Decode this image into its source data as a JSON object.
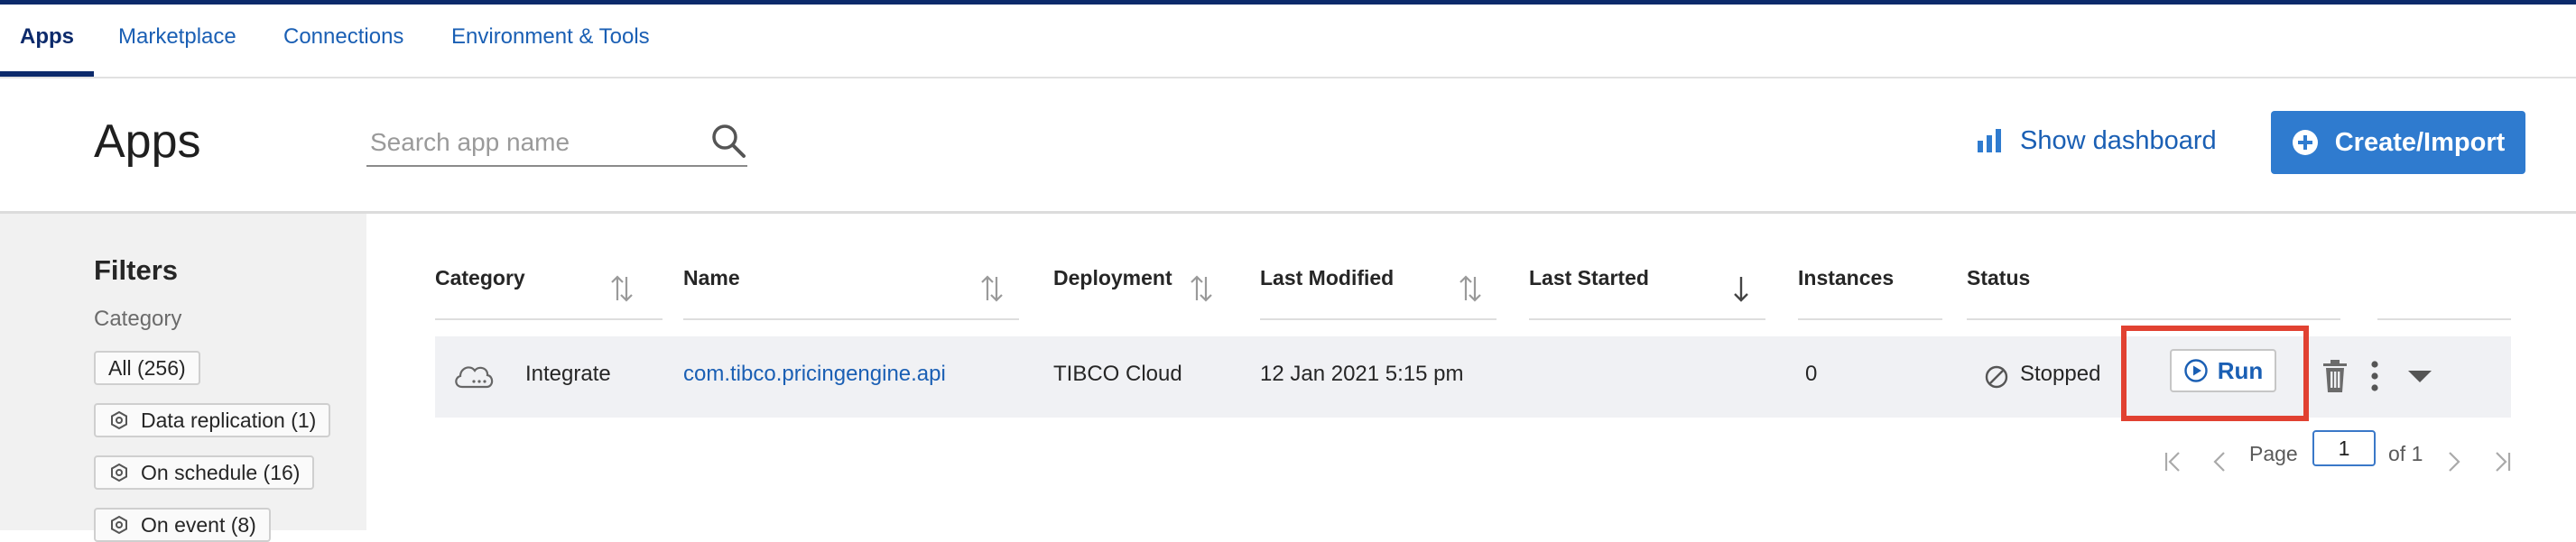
{
  "nav": {
    "tabs": [
      {
        "label": "Apps"
      },
      {
        "label": "Marketplace"
      },
      {
        "label": "Connections"
      },
      {
        "label": "Environment & Tools"
      }
    ]
  },
  "header": {
    "title": "Apps",
    "search": {
      "placeholder": "Search app name",
      "value": ""
    },
    "show_dashboard": "Show dashboard",
    "create_import": "Create/Import"
  },
  "filters": {
    "title": "Filters",
    "category_label": "Category",
    "chips": [
      {
        "label": "All (256)"
      },
      {
        "label": "Data replication (1)"
      },
      {
        "label": "On schedule (16)"
      },
      {
        "label": "On event (8)"
      }
    ]
  },
  "table": {
    "headers": {
      "category": "Category",
      "name": "Name",
      "deployment": "Deployment",
      "last_modified": "Last Modified",
      "last_started": "Last Started",
      "instances": "Instances",
      "status": "Status"
    },
    "rows": [
      {
        "category": "Integrate",
        "name": "com.tibco.pricingengine.api",
        "deployment": "TIBCO Cloud",
        "last_modified": "12 Jan 2021 5:15 pm",
        "last_started": "",
        "instances": "0",
        "status": "Stopped",
        "run_label": "Run"
      }
    ]
  },
  "pagination": {
    "page_label": "Page",
    "current_page": "1",
    "of_label": "of 1"
  },
  "colors": {
    "accent": "#2f7bcf",
    "link": "#1a5fb4",
    "nav_active": "#0c2a6b",
    "highlight": "#e14131"
  },
  "icons": [
    "search-icon",
    "bar-chart-icon",
    "plus-circle-icon",
    "app-filter-icon",
    "sort-icon",
    "sort-desc-icon",
    "cloud-icon",
    "stopped-icon",
    "play-circle-icon",
    "trash-icon",
    "more-vertical-icon",
    "caret-down-icon",
    "first-page-icon",
    "prev-page-icon",
    "next-page-icon",
    "last-page-icon"
  ]
}
